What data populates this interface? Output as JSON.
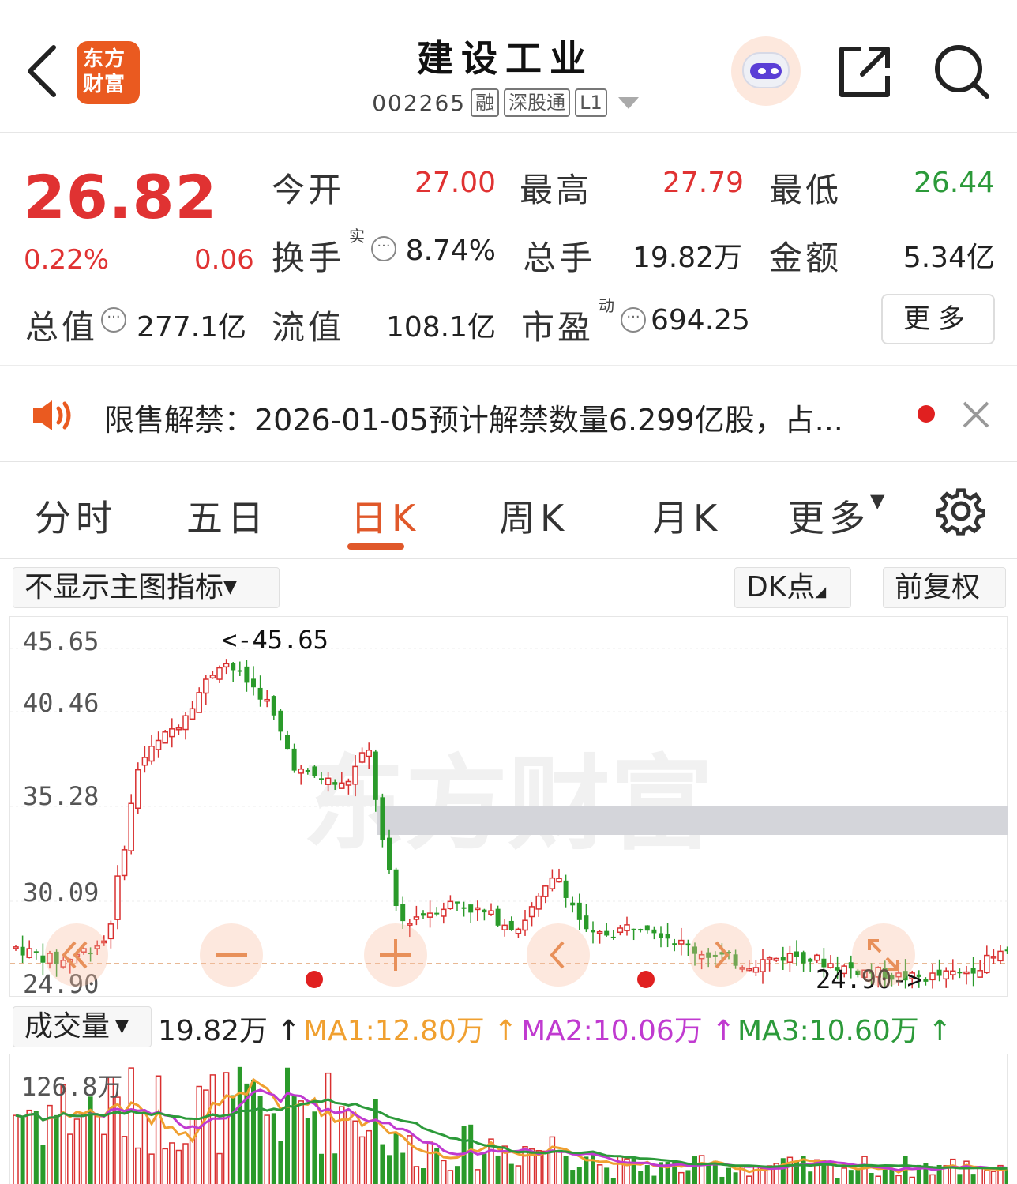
{
  "header": {
    "logo_line1": "东方",
    "logo_line2": "财富",
    "stock_name": "建设工业",
    "stock_code": "002265",
    "tags": [
      "融",
      "深股通",
      "L1"
    ]
  },
  "quote": {
    "price": "26.82",
    "change_pct": "0.22%",
    "change": "0.06",
    "open_label": "今开",
    "open": "27.00",
    "high_label": "最高",
    "high": "27.79",
    "low_label": "最低",
    "low": "26.44",
    "turnover_label": "换手",
    "turnover_sup": "实",
    "turnover": "8.74%",
    "volume_label": "总手",
    "volume": "19.82万",
    "amount_label": "金额",
    "amount": "5.34亿",
    "mktcap_label": "总值",
    "mktcap": "277.1亿",
    "float_label": "流值",
    "float_cap": "108.1亿",
    "pe_label": "市盈",
    "pe_sup": "动",
    "pe": "694.25",
    "more_label": "更多"
  },
  "notice": {
    "text": "限售解禁：2026-01-05预计解禁数量6.299亿股，占..."
  },
  "tabs": [
    "分时",
    "五日",
    "日K",
    "周K",
    "月K",
    "更多"
  ],
  "chart_toolbar": {
    "indicator_select": "不显示主图指标",
    "dk_label": "DK点",
    "adjust_label": "前复权"
  },
  "kline": {
    "y_ticks": [
      "45.65",
      "40.46",
      "35.28",
      "30.09",
      "24.90"
    ],
    "max_label": "<-45.65",
    "min_label": "24.90->",
    "watermark": "东方财富"
  },
  "volume": {
    "select_label": "成交量",
    "vol": "19.82万",
    "ma1": "MA1:12.80万",
    "ma2": "MA2:10.06万",
    "ma3": "MA3:10.60万",
    "y_tick": "126.8万",
    "colors": {
      "ma1": "#f0a030",
      "ma2": "#c03ad0",
      "ma3": "#2c9a3a"
    }
  }
}
